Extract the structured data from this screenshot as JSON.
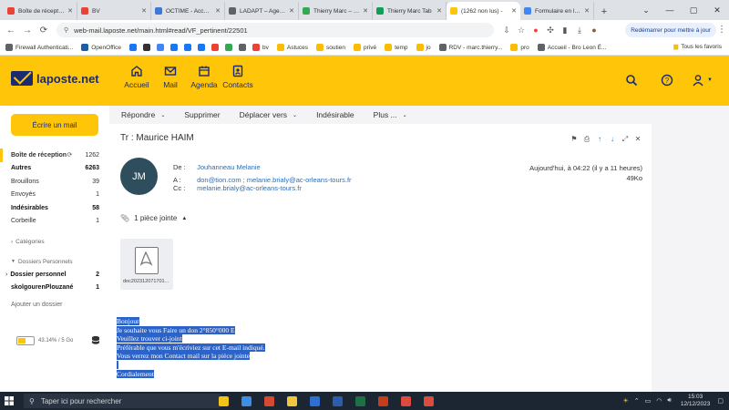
{
  "browser": {
    "tabs": [
      {
        "title": "Boîte de réception",
        "favicon_color": "#ea4335",
        "active": false
      },
      {
        "title": "BV",
        "favicon_color": "#ea4335",
        "active": false
      },
      {
        "title": "OCTIME - Accueil",
        "favicon_color": "#3c78d8",
        "active": false
      },
      {
        "title": "LADAPT – Agenda",
        "favicon_color": "#5f6368",
        "active": false
      },
      {
        "title": "Thierry Marc – Google",
        "favicon_color": "#34a853",
        "active": false
      },
      {
        "title": "Thierry Marc Tab",
        "favicon_color": "#0f9d58",
        "active": false
      },
      {
        "title": "(1262 non lus) - ",
        "favicon_color": "#ffc508",
        "active": true
      },
      {
        "title": "Formulaire en ligne",
        "favicon_color": "#4285f4",
        "active": false
      }
    ],
    "new_tab": "+",
    "url": "web-mail.laposte.net/main.html#read/VF_pertinent/22501",
    "restart_label": "Redémarrer pour mettre à jour",
    "bookmarks": [
      {
        "label": "Firewall Authenticati...",
        "color": "#5f6368"
      },
      {
        "label": "OpenOffice",
        "color": "#1c5fa8"
      },
      {
        "label": "",
        "color": "#1877f2"
      },
      {
        "label": "",
        "color": "#333333"
      },
      {
        "label": "",
        "color": "#4285f4"
      },
      {
        "label": "",
        "color": "#1877f2"
      },
      {
        "label": "",
        "color": "#1877f2"
      },
      {
        "label": "",
        "color": "#1877f2"
      },
      {
        "label": "",
        "color": "#ea4335"
      },
      {
        "label": "",
        "color": "#34a853"
      },
      {
        "label": "",
        "color": "#5f6368"
      },
      {
        "label": "bv",
        "color": "#ea4335"
      },
      {
        "label": "Astuces",
        "color": "#fbbc04"
      },
      {
        "label": "soutien",
        "color": "#fbbc04"
      },
      {
        "label": "privé",
        "color": "#fbbc04"
      },
      {
        "label": "temp",
        "color": "#fbbc04"
      },
      {
        "label": "jo",
        "color": "#fbbc04"
      },
      {
        "label": "RDV - marc.thierry...",
        "color": "#5f6368"
      },
      {
        "label": "pro",
        "color": "#fbbc04"
      },
      {
        "label": "Accueil - Bro Leon É...",
        "color": "#5f6368"
      }
    ],
    "all_bookmarks": "Tous les favoris"
  },
  "app": {
    "logo": "laposte.net",
    "nav": [
      {
        "label": "Accueil",
        "icon": "home-icon"
      },
      {
        "label": "Mail",
        "icon": "mail-icon"
      },
      {
        "label": "Agenda",
        "icon": "calendar-icon"
      },
      {
        "label": "Contacts",
        "icon": "contacts-icon"
      }
    ],
    "compose_label": "Écrire un mail",
    "folders": [
      {
        "name": "Boîte de réception",
        "count": "1262",
        "style": "sel"
      },
      {
        "name": "Autres",
        "count": "6263",
        "style": "bold"
      },
      {
        "name": "Brouillons",
        "count": "39",
        "style": ""
      },
      {
        "name": "Envoyés",
        "count": "1",
        "style": ""
      },
      {
        "name": "Indésirables",
        "count": "58",
        "style": "bold"
      },
      {
        "name": "Corbeille",
        "count": "1",
        "style": ""
      }
    ],
    "categories_label": "Catégories",
    "personal_label": "Dossiers Personnels",
    "personal_folders": [
      {
        "name": "Dossier personnel",
        "count": "2"
      },
      {
        "name": "skolgourenPlouzané",
        "count": "1"
      }
    ],
    "add_folder": "Ajouter un dossier",
    "quota": {
      "text": "43.14% / 5 Go",
      "fraction": 0.4314
    }
  },
  "toolbar": {
    "reply": "Répondre",
    "delete": "Supprimer",
    "move": "Déplacer vers",
    "spam": "Indésirable",
    "more": "Plus ..."
  },
  "message": {
    "subject": "Tr : Maurice HAIM",
    "initials": "JM",
    "from_key": "De :",
    "from": "Jouhanneau Melanie",
    "to_key": "A :",
    "to": "don@tion.com ; melanie.brialy@ac-orleans-tours.fr",
    "cc_key": "Cc :",
    "cc": "melanie.brialy@ac-orleans-tours.fr",
    "date": "Aujourd'hui, à 04:22 (il y a 11 heures)",
    "size": "49Ko",
    "attachments_label": "1 pièce jointe",
    "attachment_name": "doc20231207170112.pdf",
    "body_lines": [
      "Bonjour",
      "Je souhaite vous Faire un don 2°850°000 E",
      "Veuillez trouver ci-joint",
      "Préférable que vous m'écriviez sur cet E-mail indiqué.",
      "Vous verrez mon Contact mail sur la pièce jointe",
      "",
      "Cordialement"
    ]
  },
  "taskbar": {
    "search_placeholder": "Taper ici pour rechercher",
    "time": "15:03",
    "date": "12/12/2023",
    "apps": [
      "#f0c419",
      "#3c8ee6",
      "#d44a31",
      "#f3c53b",
      "#2f6fd1",
      "#2b5cad",
      "#1e7145",
      "#c43e1c",
      "#dd4b3e",
      "#dd4b3e"
    ]
  }
}
